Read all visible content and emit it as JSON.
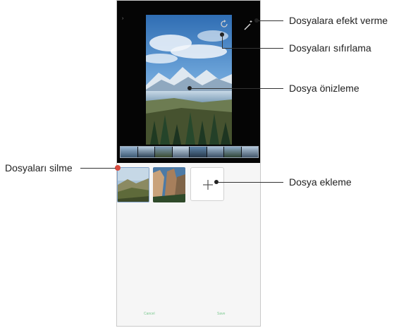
{
  "screen": {
    "header": {
      "crumb_inactive": "",
      "crumb_active": "",
      "wand_caption": ""
    },
    "bottom_bar": {
      "cancel_label": "Cancel",
      "save_label": "Save"
    },
    "icons": {
      "effects": "magic-wand-icon",
      "reset": "reset-icon",
      "add": "plus-icon"
    },
    "colors": {
      "accent_blue": "#4a8fd0",
      "delete_badge": "#d84a3e",
      "button_green": "#7bc98f"
    }
  },
  "callouts": {
    "effects": "Dosyalara efekt verme",
    "reset": "Dosyaları sıfırlama",
    "preview": "Dosya önizleme",
    "delete": "Dosyaları silme",
    "add": "Dosya ekleme"
  }
}
